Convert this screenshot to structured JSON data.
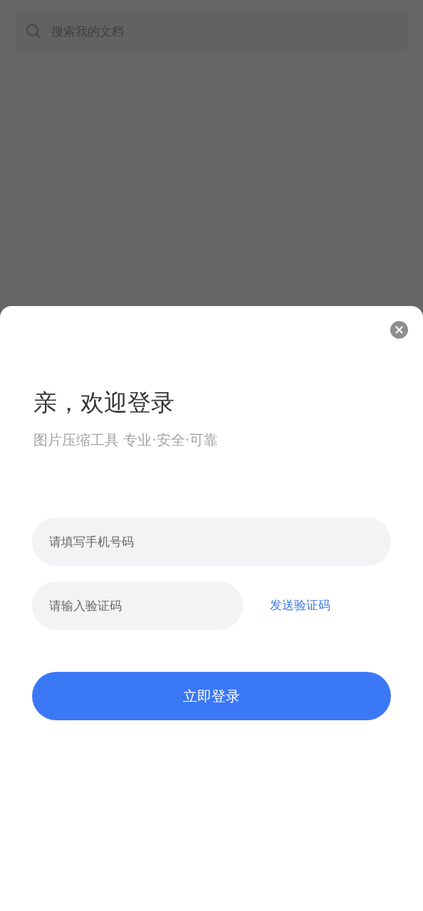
{
  "search": {
    "placeholder": "搜索我的文档"
  },
  "login": {
    "title": "亲，欢迎登录",
    "subtitle": "图片压缩工具 专业·安全·可靠",
    "phone": {
      "placeholder": "请填写手机号码"
    },
    "code": {
      "placeholder": "请输入验证码"
    },
    "send_code": "发送验证码",
    "submit": "立即登录"
  }
}
